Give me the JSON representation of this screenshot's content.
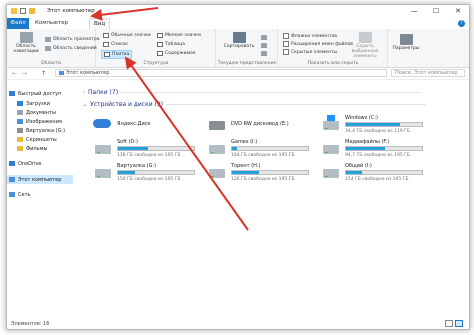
{
  "window": {
    "title": "Этот компьютер",
    "minimize": "—",
    "maximize": "☐",
    "close": "✕"
  },
  "tabs": [
    {
      "label": "Файл"
    },
    {
      "label": "Компьютер"
    },
    {
      "label": "Вид"
    }
  ],
  "help_label": "?",
  "ribbon": {
    "panels": {
      "nav_area": "Область навигации",
      "preview": "Область просмотра",
      "details": "Область сведений",
      "group": "Области"
    },
    "layout": {
      "items": [
        "Обычные значки",
        "Список",
        "Плитка",
        "Мелкие значки",
        "Таблица",
        "Содержимое"
      ],
      "selected": "Плитка",
      "group": "Структура"
    },
    "current_view": {
      "sort": "Сортировать",
      "group": "Текущее представление"
    },
    "show_hide": {
      "items": [
        "Флажки элементов",
        "Расширения имен файлов",
        "Скрытые элементы"
      ],
      "hide_selected": "Скрыть выбранные элементы",
      "group": "Показать или скрыть"
    },
    "options": "Параметры"
  },
  "nav": {
    "back": "←",
    "forward": "→",
    "up": "↑",
    "address": "Этот компьютер",
    "search_placeholder": "Поиск: Этот компьютер"
  },
  "sidebar": {
    "items": [
      {
        "label": "Быстрый доступ",
        "icon": "star-icon",
        "color": "#2f7fd6"
      },
      {
        "label": "Загрузки",
        "icon": "download-icon",
        "color": "#2f7fd6"
      },
      {
        "label": "Документы",
        "icon": "documents-icon",
        "color": "#9aa3ad"
      },
      {
        "label": "Изображения",
        "icon": "images-icon",
        "color": "#4a90d9"
      },
      {
        "label": "Виртуалка (G:)",
        "icon": "drive-icon",
        "color": "#8b8f94"
      },
      {
        "label": "Скриншоты",
        "icon": "folder-icon",
        "color": "#e8b93a"
      },
      {
        "label": "Фильмы",
        "icon": "folder-icon",
        "color": "#e8b93a"
      },
      {
        "label": "OneDrive",
        "icon": "cloud-icon",
        "color": "#2f7fd6"
      },
      {
        "label": "Этот компьютер",
        "icon": "computer-icon",
        "color": "#4a90d9"
      },
      {
        "label": "Сеть",
        "icon": "network-icon",
        "color": "#4a90d9"
      }
    ]
  },
  "content": {
    "folders_header": "Папки (7)",
    "devices_header": "Устройства и диски (9)",
    "drives": [
      {
        "name": "Яндекс.Диск",
        "type": "cloud",
        "free": "",
        "used": null
      },
      {
        "name": "DVD RW дисковод (E:)",
        "type": "dvd",
        "free": "",
        "used": null
      },
      {
        "name": "Windows (C:)",
        "type": "win10",
        "free": "34,4 ГБ свободно из 119 ГБ",
        "used": 0.71
      },
      {
        "name": "Soft (D:)",
        "type": "hdd",
        "free": "118 ГБ свободно из 195 ГБ",
        "used": 0.39
      },
      {
        "name": "Games (I:)",
        "type": "hdd",
        "free": "184 ГБ свободно из 195 ГБ",
        "used": 0.06
      },
      {
        "name": "Медиафайлы (F:)",
        "type": "hdd",
        "free": "94,7 ГБ свободно из 195 ГБ",
        "used": 0.51
      },
      {
        "name": "Виртуалка (G:)",
        "type": "hdd",
        "free": "150 ГБ свободно из 195 ГБ",
        "used": 0.23
      },
      {
        "name": "Торент (H:)",
        "type": "hdd",
        "free": "126 ГБ свободно из 195 ГБ",
        "used": 0.35
      },
      {
        "name": "Общий (I:)",
        "type": "hdd",
        "free": "154 ГБ свободно из 195 ГБ",
        "used": 0.21
      }
    ]
  },
  "status": {
    "count": "Элементов: 16"
  },
  "annotation_color": "#d9342b"
}
